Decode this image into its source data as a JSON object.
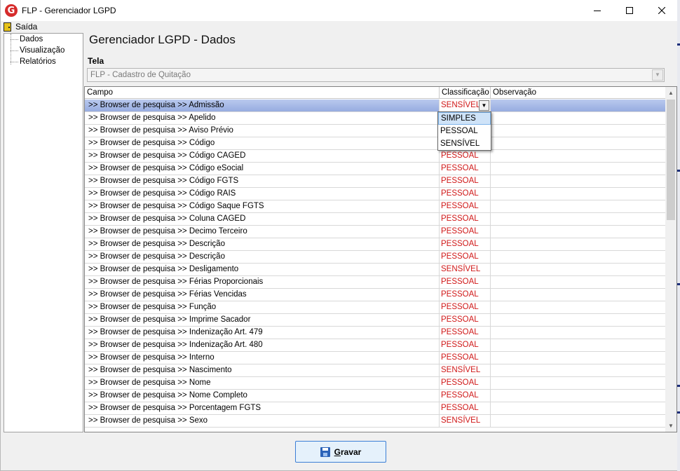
{
  "window": {
    "title": "FLP - Gerenciador LGPD",
    "icon": "app-logo-icon",
    "controls": [
      "minimize-icon",
      "maximize-icon",
      "close-icon"
    ]
  },
  "menu": {
    "items": [
      {
        "label": "Saída",
        "icon": "exit-door-icon"
      }
    ]
  },
  "tree": {
    "items": [
      {
        "label": "Dados"
      },
      {
        "label": "Visualização"
      },
      {
        "label": "Relatórios"
      }
    ]
  },
  "main": {
    "heading": "Gerenciador LGPD - Dados",
    "tela_label": "Tela",
    "tela_value": "FLP - Cadastro de Quitação"
  },
  "grid": {
    "columns": [
      "Campo",
      "Classificação",
      "Observação"
    ],
    "selected_row": 0,
    "rows": [
      {
        "campo": ">> Browser de pesquisa >> Admissão",
        "classificacao": "SENSÍVEL",
        "observacao": ""
      },
      {
        "campo": ">> Browser de pesquisa >> Apelido",
        "classificacao": "",
        "observacao": ""
      },
      {
        "campo": ">> Browser de pesquisa >> Aviso Prévio",
        "classificacao": "",
        "observacao": ""
      },
      {
        "campo": ">> Browser de pesquisa >> Código",
        "classificacao": "",
        "observacao": ""
      },
      {
        "campo": ">> Browser de pesquisa >> Código CAGED",
        "classificacao": "PESSOAL",
        "observacao": ""
      },
      {
        "campo": ">> Browser de pesquisa >> Código eSocial",
        "classificacao": "PESSOAL",
        "observacao": ""
      },
      {
        "campo": ">> Browser de pesquisa >> Código FGTS",
        "classificacao": "PESSOAL",
        "observacao": ""
      },
      {
        "campo": ">> Browser de pesquisa >> Código RAIS",
        "classificacao": "PESSOAL",
        "observacao": ""
      },
      {
        "campo": ">> Browser de pesquisa >> Código Saque FGTS",
        "classificacao": "PESSOAL",
        "observacao": ""
      },
      {
        "campo": ">> Browser de pesquisa >> Coluna CAGED",
        "classificacao": "PESSOAL",
        "observacao": ""
      },
      {
        "campo": ">> Browser de pesquisa >> Decimo Terceiro",
        "classificacao": "PESSOAL",
        "observacao": ""
      },
      {
        "campo": ">> Browser de pesquisa >> Descrição",
        "classificacao": "PESSOAL",
        "observacao": ""
      },
      {
        "campo": ">> Browser de pesquisa >> Descrição",
        "classificacao": "PESSOAL",
        "observacao": ""
      },
      {
        "campo": ">> Browser de pesquisa >> Desligamento",
        "classificacao": "SENSÍVEL",
        "observacao": ""
      },
      {
        "campo": ">> Browser de pesquisa >> Férias Proporcionais",
        "classificacao": "PESSOAL",
        "observacao": ""
      },
      {
        "campo": ">> Browser de pesquisa >> Férias Vencidas",
        "classificacao": "PESSOAL",
        "observacao": ""
      },
      {
        "campo": ">> Browser de pesquisa >> Função",
        "classificacao": "PESSOAL",
        "observacao": ""
      },
      {
        "campo": ">> Browser de pesquisa >> Imprime Sacador",
        "classificacao": "PESSOAL",
        "observacao": ""
      },
      {
        "campo": ">> Browser de pesquisa >> Indenização Art. 479",
        "classificacao": "PESSOAL",
        "observacao": ""
      },
      {
        "campo": ">> Browser de pesquisa >> Indenização Art. 480",
        "classificacao": "PESSOAL",
        "observacao": ""
      },
      {
        "campo": ">> Browser de pesquisa >> Interno",
        "classificacao": "PESSOAL",
        "observacao": ""
      },
      {
        "campo": ">> Browser de pesquisa >> Nascimento",
        "classificacao": "SENSÍVEL",
        "observacao": ""
      },
      {
        "campo": ">> Browser de pesquisa >> Nome",
        "classificacao": "PESSOAL",
        "observacao": ""
      },
      {
        "campo": ">> Browser de pesquisa >> Nome Completo",
        "classificacao": "PESSOAL",
        "observacao": ""
      },
      {
        "campo": ">> Browser de pesquisa >> Porcentagem FGTS",
        "classificacao": "PESSOAL",
        "observacao": ""
      },
      {
        "campo": ">> Browser de pesquisa >> Sexo",
        "classificacao": "SENSÍVEL",
        "observacao": ""
      }
    ]
  },
  "dropdown": {
    "open": true,
    "options": [
      "SIMPLES",
      "PESSOAL",
      "SENSÍVEL"
    ],
    "highlighted": "SIMPLES"
  },
  "footer": {
    "save_label_first": "G",
    "save_label_rest": "ravar",
    "save_icon": "floppy-disk-icon"
  },
  "colors": {
    "classification_text": "#d01818",
    "selected_row": "#a9bbe8",
    "dropdown_highlight": "#cfe3f8"
  }
}
